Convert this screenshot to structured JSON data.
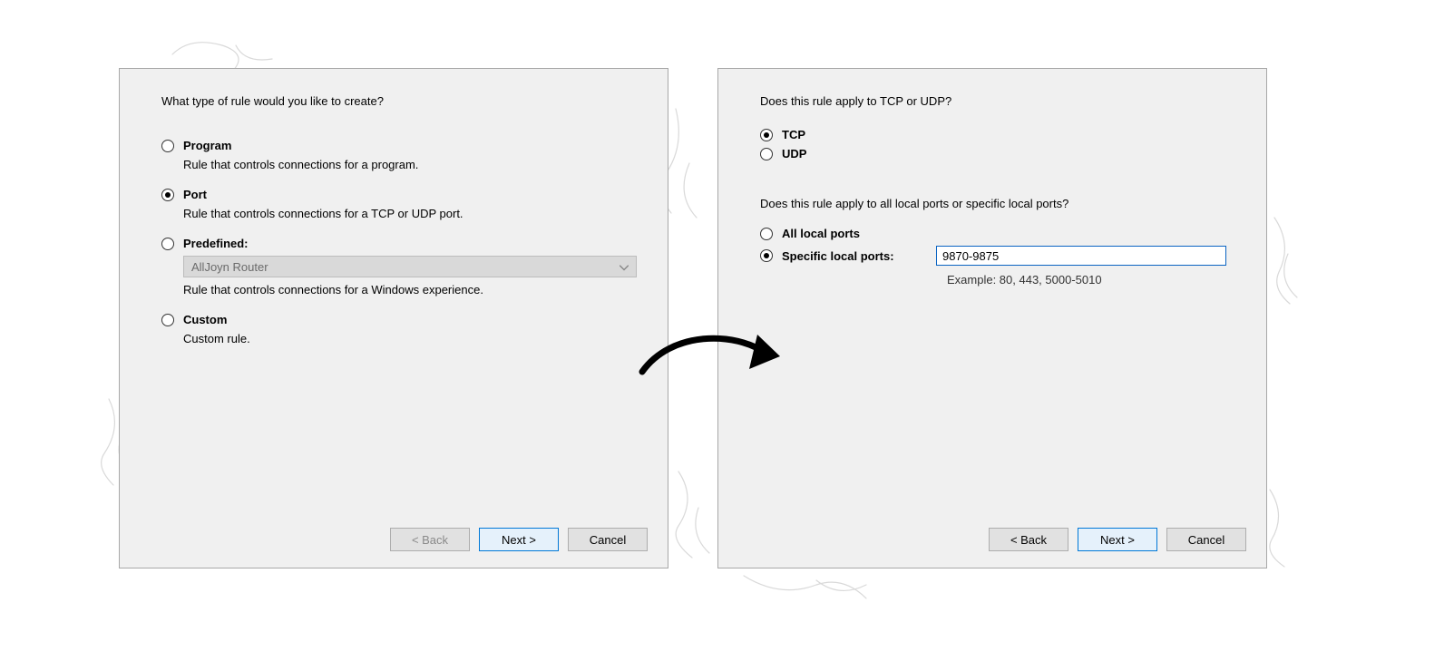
{
  "left": {
    "prompt": "What type of rule would you like to create?",
    "options": {
      "program": {
        "label": "Program",
        "desc": "Rule that controls connections for a program.",
        "checked": false
      },
      "port": {
        "label": "Port",
        "desc": "Rule that controls connections for a TCP or UDP port.",
        "checked": true
      },
      "predefined": {
        "label": "Predefined:",
        "desc": "Rule that controls connections for a Windows experience.",
        "checked": false,
        "combo_value": "AllJoyn Router"
      },
      "custom": {
        "label": "Custom",
        "desc": "Custom rule.",
        "checked": false
      }
    },
    "buttons": {
      "back": "< Back",
      "next": "Next >",
      "cancel": "Cancel"
    }
  },
  "right": {
    "prompt_protocol": "Does this rule apply to TCP or UDP?",
    "protocol": {
      "tcp": {
        "label": "TCP",
        "checked": true
      },
      "udp": {
        "label": "UDP",
        "checked": false
      }
    },
    "prompt_ports": "Does this rule apply to all local ports or specific local ports?",
    "ports": {
      "all": {
        "label": "All local ports",
        "checked": false
      },
      "specific": {
        "label": "Specific local ports:",
        "checked": true,
        "value": "9870-9875",
        "example": "Example: 80, 443, 5000-5010"
      }
    },
    "buttons": {
      "back": "< Back",
      "next": "Next >",
      "cancel": "Cancel"
    }
  }
}
